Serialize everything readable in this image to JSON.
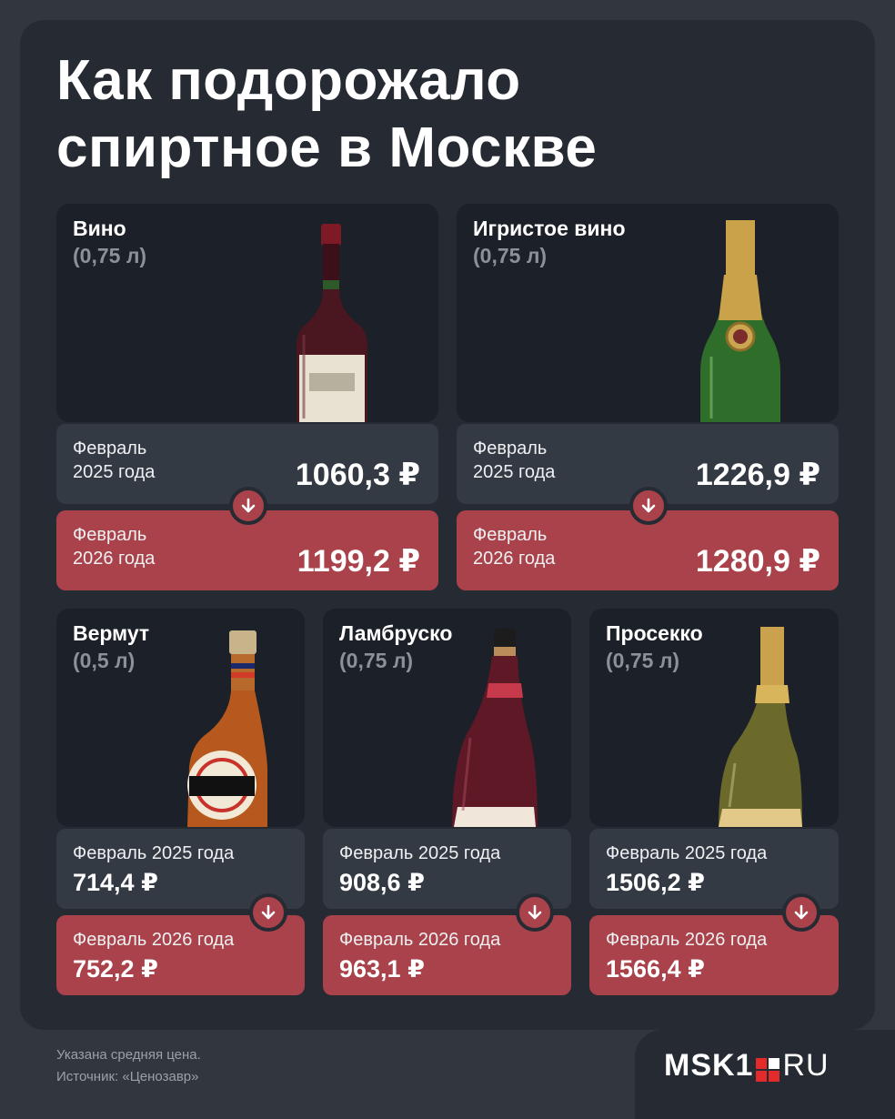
{
  "title": "Как подорожало\nспиртное в Москве",
  "products": [
    {
      "name": "Вино",
      "volume": "(0,75 л)",
      "old_label": "Февраль\n2025 года",
      "old_price": "1060,3 ₽",
      "new_label": "Февраль\n2026 года",
      "new_price": "1199,2 ₽",
      "bottle": "red-wine-bottle"
    },
    {
      "name": "Игристое вино",
      "volume": "(0,75 л)",
      "old_label": "Февраль\n2025 года",
      "old_price": "1226,9 ₽",
      "new_label": "Февраль\n2026 года",
      "new_price": "1280,9 ₽",
      "bottle": "champagne-bottle"
    },
    {
      "name": "Вермут",
      "volume": "(0,5 л)",
      "old_label": "Февраль 2025 года",
      "old_price": "714,4 ₽",
      "new_label": "Февраль 2026 года",
      "new_price": "752,2 ₽",
      "bottle": "vermouth-bottle"
    },
    {
      "name": "Ламбруско",
      "volume": "(0,75 л)",
      "old_label": "Февраль 2025 года",
      "old_price": "908,6 ₽",
      "new_label": "Февраль 2026 года",
      "new_price": "963,1 ₽",
      "bottle": "lambrusco-bottle"
    },
    {
      "name": "Просекко",
      "volume": "(0,75 л)",
      "old_label": "Февраль 2025 года",
      "old_price": "1506,2 ₽",
      "new_label": "Февраль 2026 года",
      "new_price": "1566,4 ₽",
      "bottle": "prosecco-bottle"
    }
  ],
  "footer": {
    "note": "Указана средняя цена.",
    "source": "Источник: «Ценозавр»"
  },
  "logo": {
    "left": "MSK1",
    "right": "RU"
  },
  "colors": {
    "background": "#32373f",
    "card": "#252a33",
    "panel": "#1c2028",
    "old_price_box": "#343a44",
    "new_price_box": "#a9424a",
    "accent_red": "#e32b2b"
  },
  "icons": {
    "arrow": "arrow-down-icon"
  }
}
